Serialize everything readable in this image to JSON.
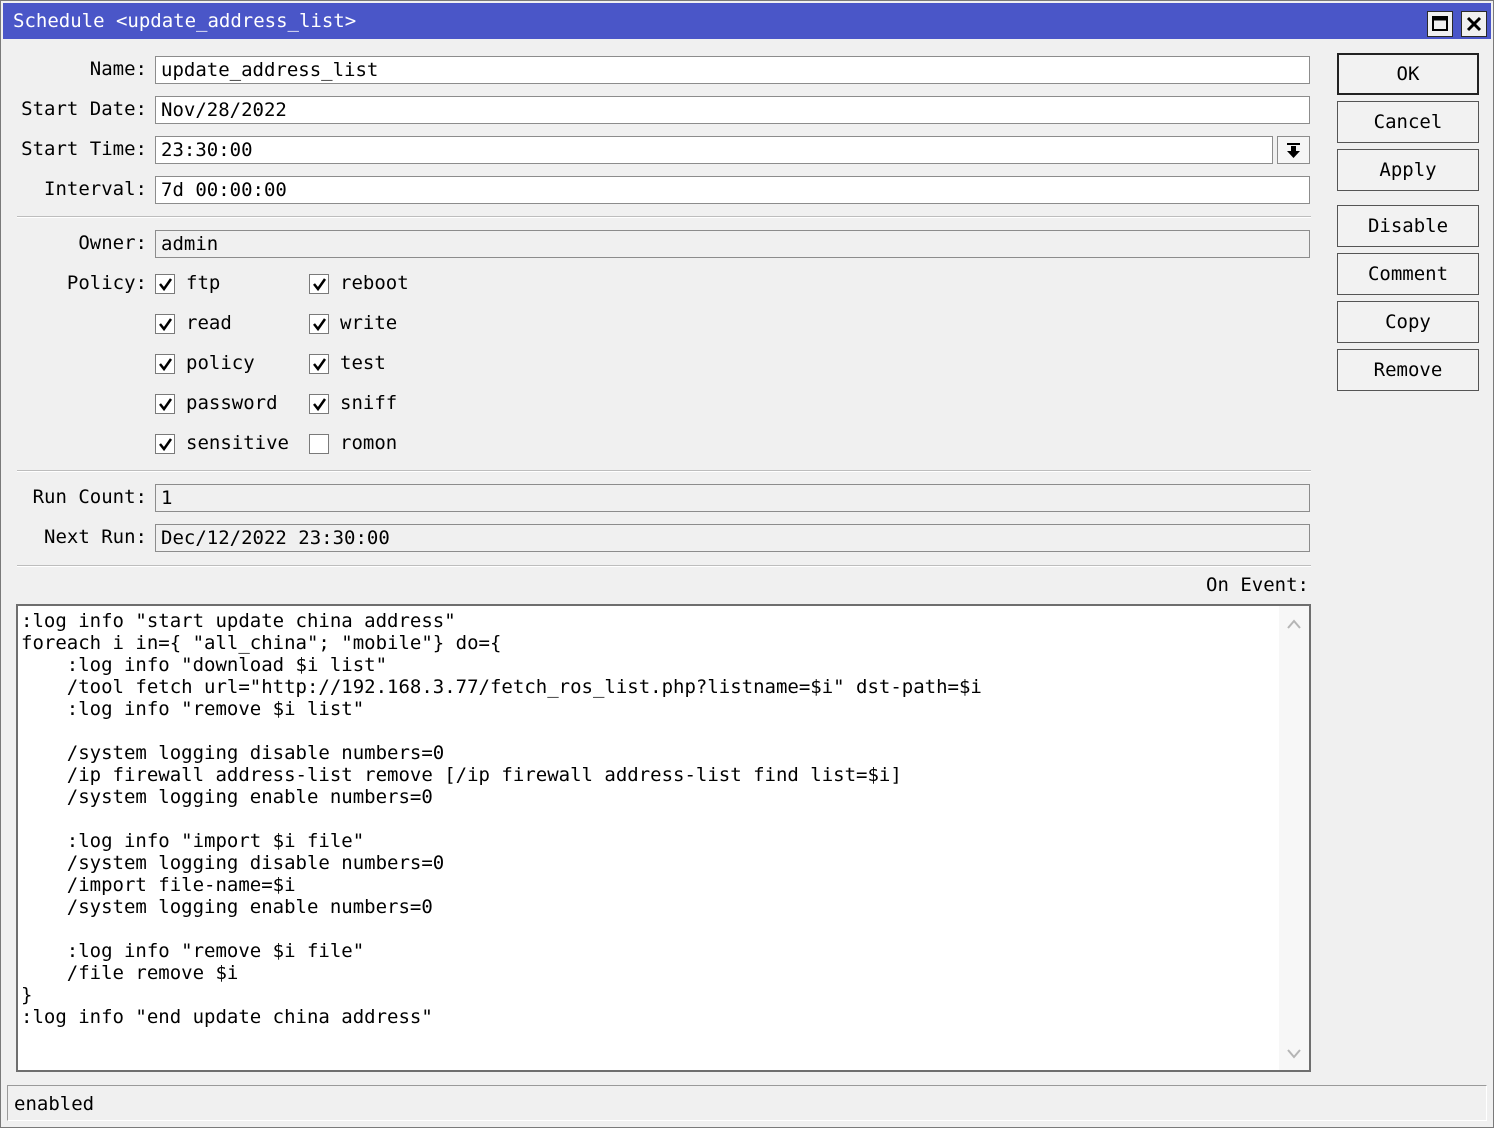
{
  "window": {
    "title": "Schedule <update_address_list>",
    "maximize_icon": "maximize-icon",
    "close_icon": "close-icon",
    "titlebar_color": "#4a56c8"
  },
  "form": {
    "name_label": "Name:",
    "name_value": "update_address_list",
    "start_date_label": "Start Date:",
    "start_date_value": "Nov/28/2022",
    "start_time_label": "Start Time:",
    "start_time_value": "23:30:00",
    "start_time_dropdown_icon": "arrow-down-icon",
    "interval_label": "Interval:",
    "interval_value": "7d 00:00:00",
    "owner_label": "Owner:",
    "owner_value": "admin",
    "policy_label": "Policy:",
    "policies": [
      {
        "label": "ftp",
        "checked": true
      },
      {
        "label": "read",
        "checked": true
      },
      {
        "label": "policy",
        "checked": true
      },
      {
        "label": "password",
        "checked": true
      },
      {
        "label": "sensitive",
        "checked": true
      },
      {
        "label": "reboot",
        "checked": true
      },
      {
        "label": "write",
        "checked": true
      },
      {
        "label": "test",
        "checked": true
      },
      {
        "label": "sniff",
        "checked": true
      },
      {
        "label": "romon",
        "checked": false
      }
    ],
    "run_count_label": "Run Count:",
    "run_count_value": "1",
    "next_run_label": "Next Run:",
    "next_run_value": "Dec/12/2022 23:30:00",
    "on_event_label": "On Event:",
    "on_event_script": ":log info \"start update china address\"\nforeach i in={ \"all_china\"; \"mobile\"} do={\n    :log info \"download $i list\"\n    /tool fetch url=\"http://192.168.3.77/fetch_ros_list.php?listname=$i\" dst-path=$i\n    :log info \"remove $i list\"\n\n    /system logging disable numbers=0\n    /ip firewall address-list remove [/ip firewall address-list find list=$i]\n    /system logging enable numbers=0\n\n    :log info \"import $i file\"\n    /system logging disable numbers=0\n    /import file-name=$i\n    /system logging enable numbers=0\n\n    :log info \"remove $i file\"\n    /file remove $i\n}\n:log info \"end update china address\""
  },
  "buttons": {
    "ok": "OK",
    "cancel": "Cancel",
    "apply": "Apply",
    "disable": "Disable",
    "comment": "Comment",
    "copy": "Copy",
    "remove": "Remove"
  },
  "status": {
    "text": "enabled"
  }
}
